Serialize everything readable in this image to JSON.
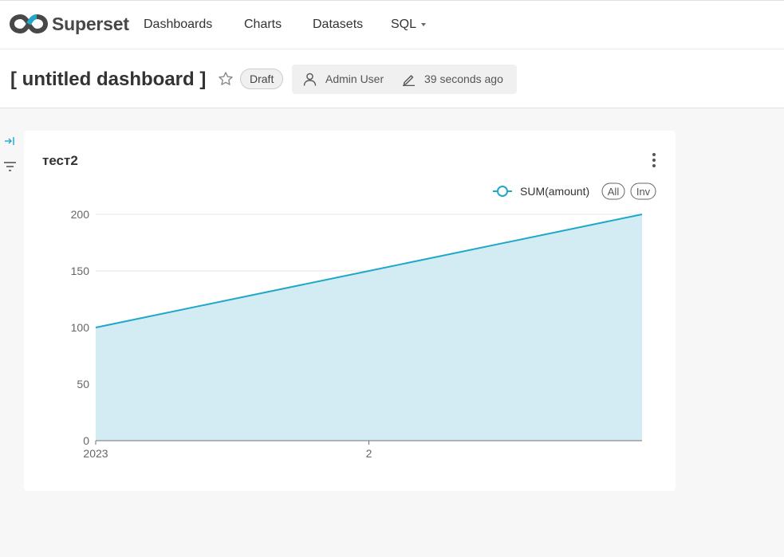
{
  "app": {
    "name": "Superset"
  },
  "nav": {
    "items": [
      {
        "label": "Dashboards"
      },
      {
        "label": "Charts"
      },
      {
        "label": "Datasets"
      },
      {
        "label": "SQL"
      }
    ]
  },
  "dashboard": {
    "title": "[ untitled dashboard ]",
    "status": "Draft",
    "owner": "Admin User",
    "modified": "39 seconds ago"
  },
  "chart": {
    "title": "тест2",
    "legend_buttons": [
      "All",
      "Inv"
    ]
  },
  "colors": {
    "series": "#1fa8c9",
    "area": "#d3ecf3",
    "brand_blue": "#20a7c9",
    "brand_dark": "#484848"
  },
  "icons": [
    "superset-logo-icon",
    "star-icon",
    "user-icon",
    "pencil-icon",
    "collapse-panel-icon",
    "filter-icon",
    "more-vertical-icon"
  ],
  "chart_data": {
    "type": "area",
    "title": "тест2",
    "series": [
      {
        "name": "SUM(amount)",
        "values": [
          100,
          150,
          200
        ]
      }
    ],
    "x": [
      "2023",
      "2",
      ""
    ],
    "x_ticks": [
      "2023",
      "2"
    ],
    "y_ticks": [
      0,
      50,
      100,
      150,
      200
    ],
    "ylim": [
      0,
      200
    ],
    "grid": true,
    "legend_position": "top-right"
  }
}
